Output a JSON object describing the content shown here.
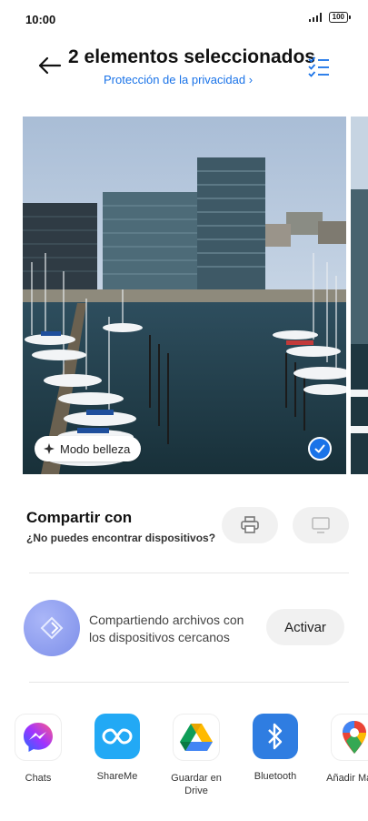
{
  "status_bar": {
    "time": "10:00",
    "battery": "100"
  },
  "header": {
    "title": "2 elementos seleccionados",
    "privacy_link": "Protección de la privacidad"
  },
  "photo": {
    "beauty_mode": "Modo belleza"
  },
  "share": {
    "title": "Compartir con",
    "help": "¿No puedes encontrar dispositivos?"
  },
  "nearby": {
    "text": "Compartiendo archivos con los dispositivos cercanos",
    "button": "Activar"
  },
  "apps": [
    {
      "label": "Chats",
      "icon": "messenger-icon"
    },
    {
      "label": "ShareMe",
      "icon": "shareme-icon"
    },
    {
      "label": "Guardar en Drive",
      "icon": "google-drive-icon"
    },
    {
      "label": "Bluetooth",
      "icon": "bluetooth-icon"
    },
    {
      "label": "Añadir Maps",
      "icon": "google-maps-icon"
    }
  ],
  "colors": {
    "accent": "#1a73e8",
    "nearby": "#8b9af0"
  }
}
